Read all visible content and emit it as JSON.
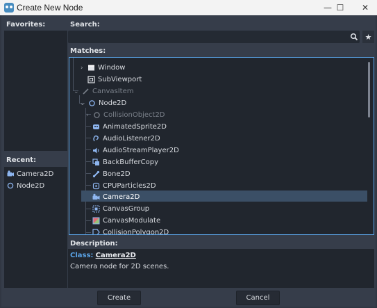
{
  "window": {
    "title": "Create New Node",
    "minimize": "—",
    "maximize": "☐",
    "close": "✕"
  },
  "favorites": {
    "label": "Favorites:"
  },
  "recent": {
    "label": "Recent:",
    "items": [
      "Camera2D",
      "Node2D"
    ]
  },
  "search": {
    "label": "Search:",
    "value": "",
    "favorite_icon": "★"
  },
  "matches": {
    "label": "Matches:",
    "items": [
      {
        "label": "Window",
        "icon": "window-icon",
        "expandable": true,
        "disabled": false
      },
      {
        "label": "SubViewport",
        "icon": "subviewport-icon",
        "expandable": false,
        "disabled": false
      },
      {
        "label": "CanvasItem",
        "icon": "pencil-icon",
        "expandable": true,
        "disabled": true
      },
      {
        "label": "Node2D",
        "icon": "node2d-icon",
        "expandable": true,
        "disabled": false
      },
      {
        "label": "CollisionObject2D",
        "icon": "collisionobject-icon",
        "expandable": true,
        "disabled": true
      },
      {
        "label": "AnimatedSprite2D",
        "icon": "animatedsprite-icon",
        "expandable": false,
        "disabled": false
      },
      {
        "label": "AudioListener2D",
        "icon": "audiolistener-icon",
        "expandable": false,
        "disabled": false
      },
      {
        "label": "AudioStreamPlayer2D",
        "icon": "speaker-icon",
        "expandable": false,
        "disabled": false
      },
      {
        "label": "BackBufferCopy",
        "icon": "backbuffer-icon",
        "expandable": false,
        "disabled": false
      },
      {
        "label": "Bone2D",
        "icon": "bone-icon",
        "expandable": false,
        "disabled": false
      },
      {
        "label": "CPUParticles2D",
        "icon": "particles-icon",
        "expandable": false,
        "disabled": false
      },
      {
        "label": "Camera2D",
        "icon": "camera-icon",
        "expandable": false,
        "disabled": false,
        "selected": true
      },
      {
        "label": "CanvasGroup",
        "icon": "canvasgroup-icon",
        "expandable": false,
        "disabled": false
      },
      {
        "label": "CanvasModulate",
        "icon": "canvasmodulate-icon",
        "expandable": false,
        "disabled": false
      },
      {
        "label": "CollisionPolygon2D",
        "icon": "collisionpolygon-icon",
        "expandable": false,
        "disabled": false
      }
    ]
  },
  "description": {
    "label": "Description:",
    "class_key": "Class:",
    "class_name": "Camera2D",
    "text": "Camera node for 2D scenes."
  },
  "buttons": {
    "create": "Create",
    "cancel": "Cancel"
  },
  "colors": {
    "accent": "#5aa3e6",
    "panel": "#21262e",
    "background": "#363d4a",
    "selected": "#3b4f66"
  }
}
